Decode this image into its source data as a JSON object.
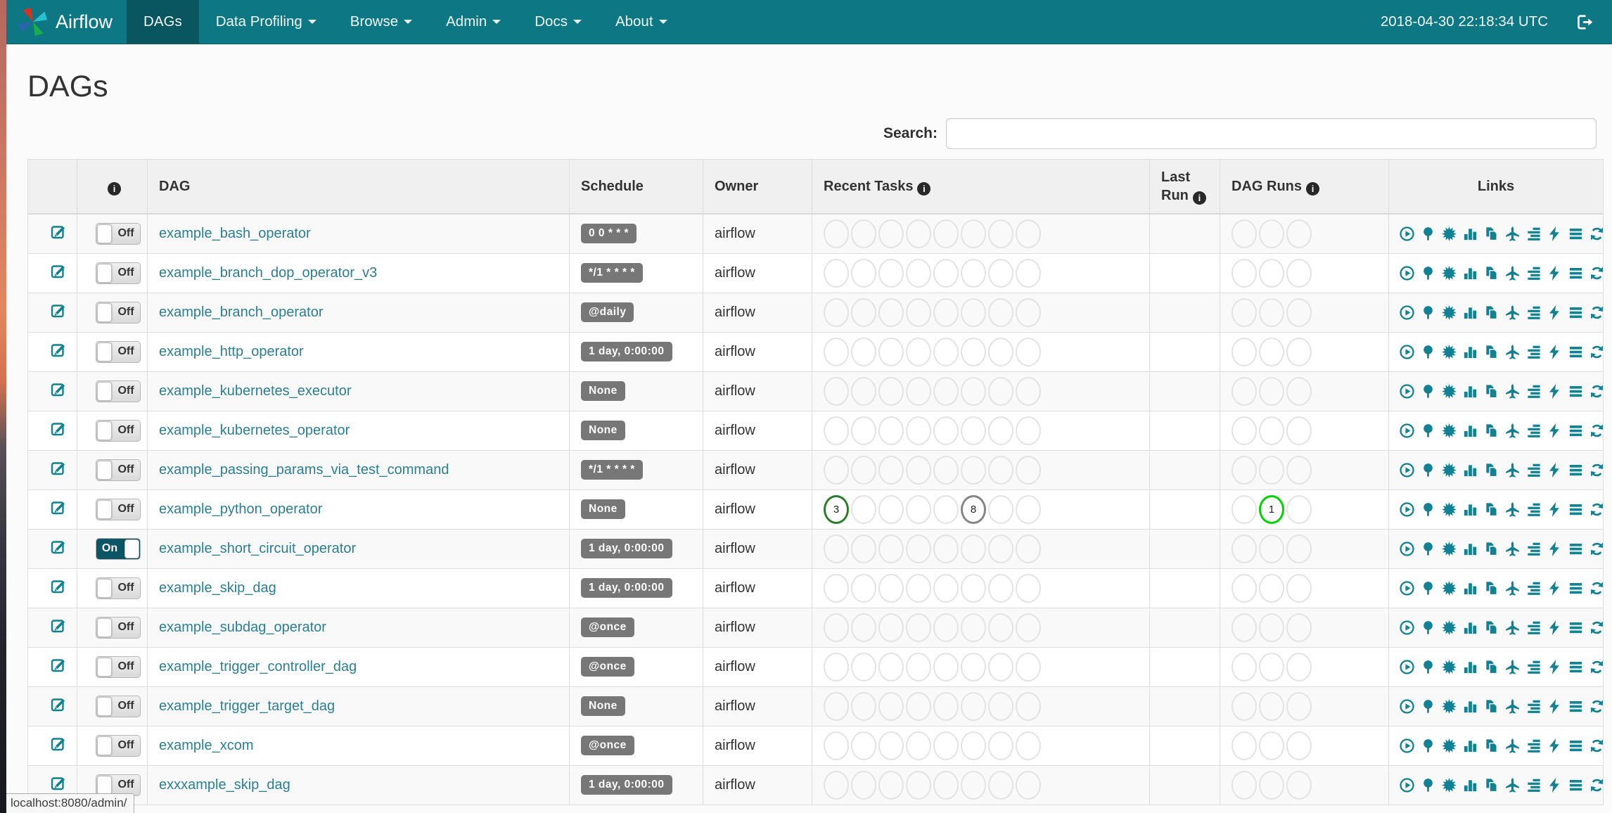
{
  "navbar": {
    "brand": "Airflow",
    "items": [
      {
        "label": "DAGs",
        "active": true,
        "dropdown": false
      },
      {
        "label": "Data Profiling",
        "active": false,
        "dropdown": true
      },
      {
        "label": "Browse",
        "active": false,
        "dropdown": true
      },
      {
        "label": "Admin",
        "active": false,
        "dropdown": true
      },
      {
        "label": "Docs",
        "active": false,
        "dropdown": true
      },
      {
        "label": "About",
        "active": false,
        "dropdown": true
      }
    ],
    "clock": "2018-04-30 22:18:34 UTC",
    "logout_icon": "sign-out-icon"
  },
  "page": {
    "title": "DAGs",
    "search_label": "Search:",
    "search_value": "",
    "status_bar": "localhost:8080/admin/"
  },
  "colors": {
    "navbar": "#0d7784",
    "navbar_active": "#0a5660",
    "link_teal": "#2a7f93",
    "icon_teal": "#118193",
    "badge_gray": "#777777",
    "toggle_on": "#0d5565",
    "task_success_green": "#2a7e2a",
    "task_queued_gray": "#868686",
    "dagrun_running_green": "#00d400",
    "empty_circle_gray": "#e3e3e3"
  },
  "table": {
    "headers": {
      "edit": "",
      "info": "info-icon",
      "dag": "DAG",
      "schedule": "Schedule",
      "owner": "Owner",
      "recent_tasks": "Recent Tasks",
      "last_run": "Last Run",
      "dag_runs": "DAG Runs",
      "links": "Links"
    },
    "recent_task_slots": 8,
    "dag_run_slots": 3,
    "links_icons": [
      "trigger-dag",
      "tree-view",
      "graph-view",
      "task-duration",
      "task-tries",
      "landing-times",
      "gantt",
      "code",
      "logs",
      "refresh"
    ],
    "rows": [
      {
        "name": "example_bash_operator",
        "toggle": "Off",
        "schedule": "0 0 * * *",
        "owner": "airflow",
        "last_run": "",
        "recent_tasks": [],
        "dag_runs": []
      },
      {
        "name": "example_branch_dop_operator_v3",
        "toggle": "Off",
        "schedule": "*/1 * * * *",
        "owner": "airflow",
        "last_run": "",
        "recent_tasks": [],
        "dag_runs": []
      },
      {
        "name": "example_branch_operator",
        "toggle": "Off",
        "schedule": "@daily",
        "owner": "airflow",
        "last_run": "",
        "recent_tasks": [],
        "dag_runs": []
      },
      {
        "name": "example_http_operator",
        "toggle": "Off",
        "schedule": "1 day, 0:00:00",
        "owner": "airflow",
        "last_run": "",
        "recent_tasks": [],
        "dag_runs": []
      },
      {
        "name": "example_kubernetes_executor",
        "toggle": "Off",
        "schedule": "None",
        "owner": "airflow",
        "last_run": "",
        "recent_tasks": [],
        "dag_runs": []
      },
      {
        "name": "example_kubernetes_operator",
        "toggle": "Off",
        "schedule": "None",
        "owner": "airflow",
        "last_run": "",
        "recent_tasks": [],
        "dag_runs": []
      },
      {
        "name": "example_passing_params_via_test_command",
        "toggle": "Off",
        "schedule": "*/1 * * * *",
        "owner": "airflow",
        "last_run": "",
        "recent_tasks": [],
        "dag_runs": []
      },
      {
        "name": "example_python_operator",
        "toggle": "Off",
        "schedule": "None",
        "owner": "airflow",
        "last_run": "",
        "recent_tasks": [
          {
            "slot": 1,
            "count": "3",
            "color": "#2a7e2a"
          },
          {
            "slot": 6,
            "count": "8",
            "color": "#868686"
          }
        ],
        "dag_runs": [
          {
            "slot": 2,
            "count": "1",
            "color": "#00d400"
          }
        ]
      },
      {
        "name": "example_short_circuit_operator",
        "toggle": "On",
        "schedule": "1 day, 0:00:00",
        "owner": "airflow",
        "last_run": "",
        "recent_tasks": [],
        "dag_runs": []
      },
      {
        "name": "example_skip_dag",
        "toggle": "Off",
        "schedule": "1 day, 0:00:00",
        "owner": "airflow",
        "last_run": "",
        "recent_tasks": [],
        "dag_runs": []
      },
      {
        "name": "example_subdag_operator",
        "toggle": "Off",
        "schedule": "@once",
        "owner": "airflow",
        "last_run": "",
        "recent_tasks": [],
        "dag_runs": []
      },
      {
        "name": "example_trigger_controller_dag",
        "toggle": "Off",
        "schedule": "@once",
        "owner": "airflow",
        "last_run": "",
        "recent_tasks": [],
        "dag_runs": []
      },
      {
        "name": "example_trigger_target_dag",
        "toggle": "Off",
        "schedule": "None",
        "owner": "airflow",
        "last_run": "",
        "recent_tasks": [],
        "dag_runs": []
      },
      {
        "name": "example_xcom",
        "toggle": "Off",
        "schedule": "@once",
        "owner": "airflow",
        "last_run": "",
        "recent_tasks": [],
        "dag_runs": []
      },
      {
        "name": "exxxample_skip_dag",
        "toggle": "Off",
        "schedule": "1 day, 0:00:00",
        "owner": "airflow",
        "last_run": "",
        "recent_tasks": [],
        "dag_runs": []
      }
    ]
  }
}
